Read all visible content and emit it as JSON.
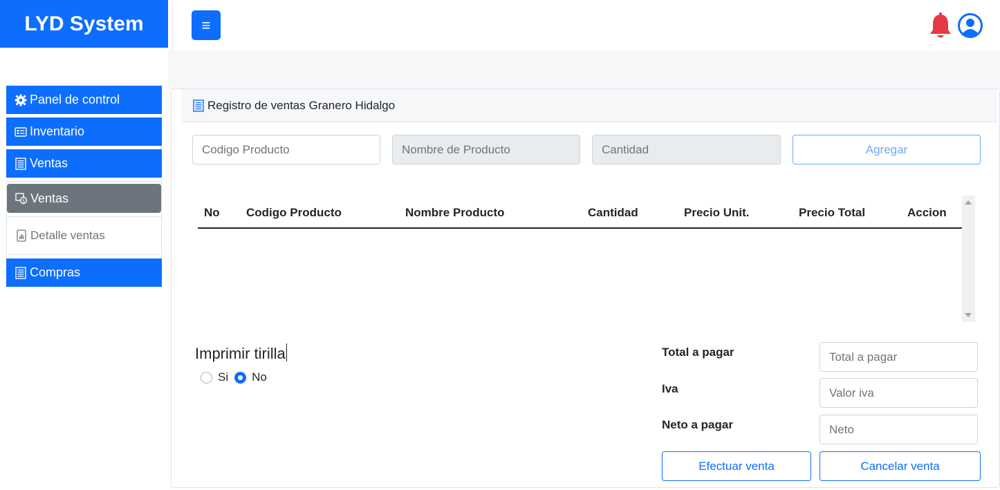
{
  "brand": {
    "title": "LYD System",
    "color": "#0d6efd"
  },
  "topbar": {
    "menu_icon": "hamburger-icon",
    "bell_icon": "bell-icon",
    "user_icon": "user-circle-icon"
  },
  "sidebar": {
    "items": [
      {
        "label": "Panel de control",
        "icon": "gear-icon"
      },
      {
        "label": "Inventario",
        "icon": "card-list-icon"
      },
      {
        "label": "Ventas",
        "icon": "receipt-icon"
      },
      {
        "label": "Compras",
        "icon": "receipt-icon"
      }
    ],
    "sub": {
      "active": {
        "label": "Ventas",
        "icon": "cash-register-icon"
      },
      "detalle": {
        "label": "Detalle ventas",
        "icon": "chart-file-icon"
      }
    }
  },
  "card": {
    "header": "Registro de ventas Granero Hidalgo",
    "form": {
      "codigo_placeholder": "Codigo Producto",
      "nombre_placeholder": "Nombre de Producto",
      "cantidad_placeholder": "Cantidad",
      "agregar_label": "Agregar"
    },
    "table": {
      "columns": [
        "No",
        "Codigo Producto",
        "Nombre Producto",
        "Cantidad",
        "Precio Unit.",
        "Precio Total",
        "Accion"
      ]
    },
    "print": {
      "title": "Imprimir tirilla",
      "option_si": "Si",
      "option_no": "No",
      "selected": "No"
    },
    "totals": {
      "total_label": "Total a pagar",
      "total_placeholder": "Total a pagar",
      "iva_label": "Iva",
      "iva_placeholder": "Valor iva",
      "neto_label": "Neto a pagar",
      "neto_placeholder": "Neto"
    },
    "actions": {
      "efectuar": "Efectuar venta",
      "cancelar": "Cancelar venta"
    }
  },
  "colors": {
    "primary": "#0d6efd",
    "secondary": "#6c757d",
    "danger": "#e53945"
  }
}
